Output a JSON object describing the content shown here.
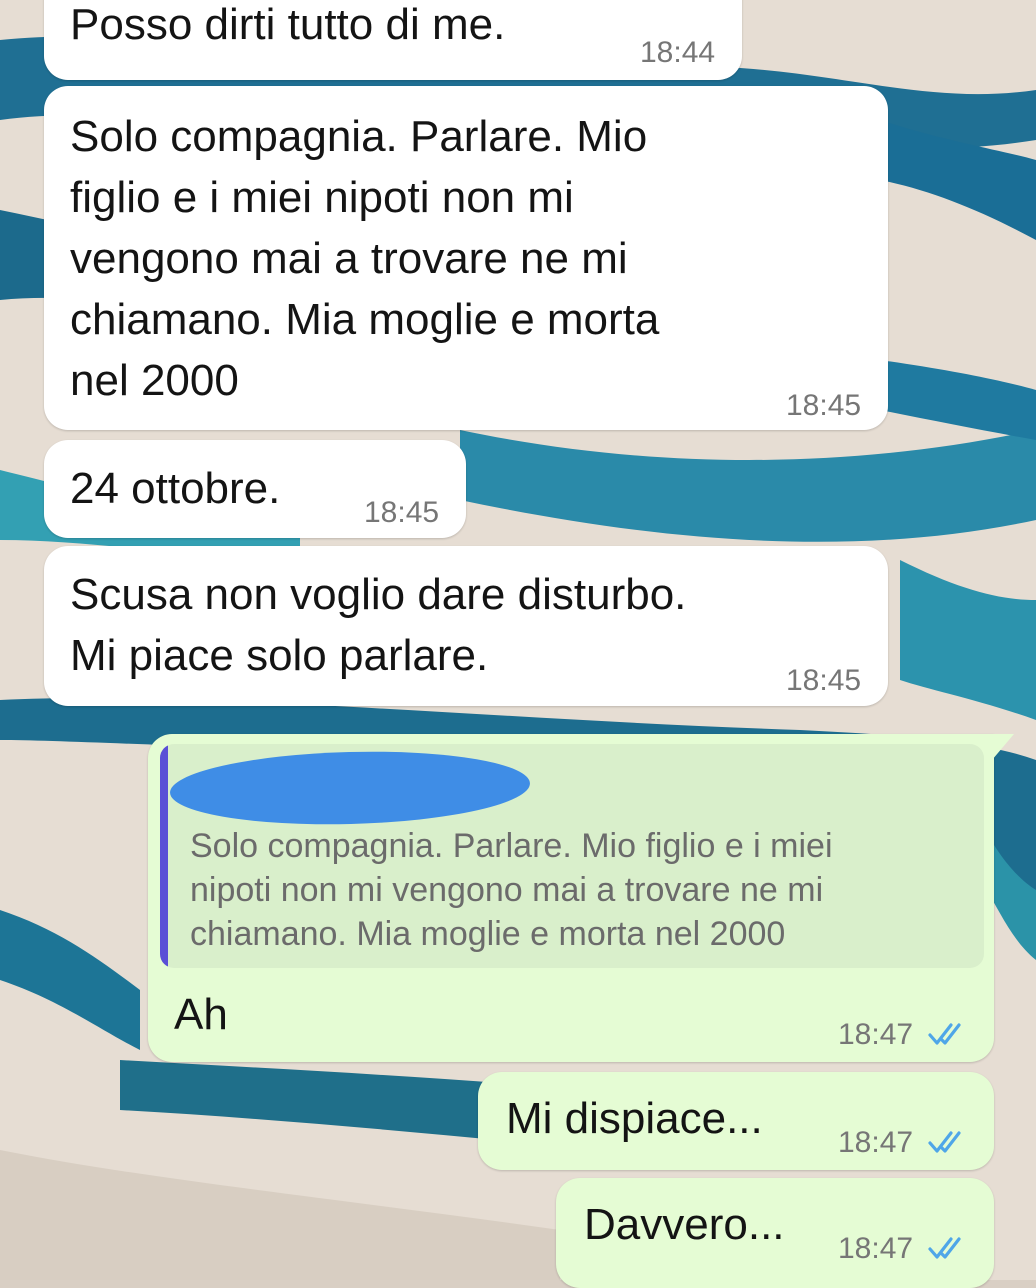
{
  "theme": {
    "incoming_bg": "#ffffff",
    "outgoing_bg": "#e5fcd4",
    "quote_bar": "#5a4fd6",
    "read_ticks": "#4fa6e8",
    "redaction": "#3f8de6"
  },
  "messages": [
    {
      "text": "Posso dirti tutto di me.",
      "time": "18:44"
    },
    {
      "text": "Solo compagnia. Parlare. Mio\nfiglio e i miei nipoti non mi\nvengono mai a trovare ne mi\nchiamano. Mia moglie e morta\nnel 2000",
      "time": "18:45"
    },
    {
      "text": "24 ottobre.",
      "time": "18:45"
    },
    {
      "text": "Scusa non voglio dare disturbo.\nMi piace solo parlare.",
      "time": "18:45"
    },
    {
      "quote": "Solo compagnia. Parlare. Mio figlio e i miei\nnipoti non mi vengono mai a trovare ne mi\nchiamano. Mia moglie e morta nel 2000",
      "text": "Ah",
      "time": "18:47",
      "status_icon": "double-check-icon"
    },
    {
      "text": "Mi dispiace...",
      "time": "18:47",
      "status_icon": "double-check-icon"
    },
    {
      "text": "Davvero...",
      "time": "18:47",
      "status_icon": "double-check-icon"
    }
  ]
}
